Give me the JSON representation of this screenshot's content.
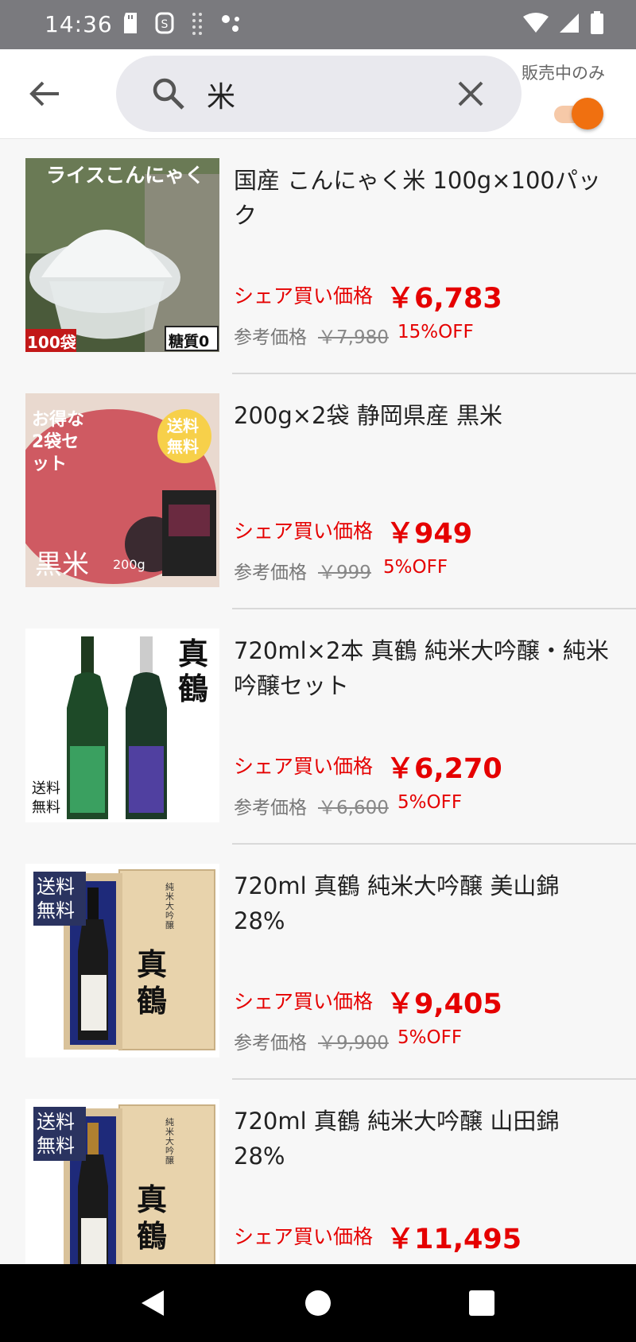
{
  "status_bar": {
    "time": "14:36"
  },
  "header": {
    "search_value": "米",
    "toggle_label": "販売中のみ",
    "toggle_on": true,
    "accent_color": "#f07010"
  },
  "items": [
    {
      "title": "国産 こんにゃく米 100g×100パック",
      "price_label": "シェア買い価格",
      "price": "￥6,783",
      "ref_label": "参考価格",
      "ref_price": "￥7,980",
      "discount": "15%OFF",
      "image": {
        "caption": "ライスこんにゃく",
        "badge_left": "100袋",
        "badge_right": "糖質0"
      }
    },
    {
      "title": "200g×2袋 静岡県産 黒米",
      "price_label": "シェア買い価格",
      "price": "￥949",
      "ref_label": "参考価格",
      "ref_price": "￥999",
      "discount": "5%OFF",
      "image": {
        "caption": "お得な2袋セット",
        "badge_right": "送料無料",
        "bottom": "黒米",
        "weight": "200g"
      }
    },
    {
      "title": "720ml×2本 真鶴 純米大吟醸・純米吟醸セット",
      "price_label": "シェア買い価格",
      "price": "￥6,270",
      "ref_label": "参考価格",
      "ref_price": "￥6,600",
      "discount": "5%OFF",
      "image": {
        "brand": "真鶴",
        "badge": "送料無料"
      }
    },
    {
      "title": "720ml 真鶴 純米大吟醸 美山錦 28%",
      "price_label": "シェア買い価格",
      "price": "￥9,405",
      "ref_label": "参考価格",
      "ref_price": "￥9,900",
      "discount": "5%OFF",
      "image": {
        "brand": "真鶴",
        "badge": "送料無料",
        "box_text": "純米大吟醸"
      }
    },
    {
      "title": "720ml 真鶴 純米大吟醸 山田錦 28%",
      "price_label": "シェア買い価格",
      "price": "￥11,495",
      "image": {
        "brand": "真鶴",
        "badge": "送料無料",
        "box_text": "純米大吟醸"
      }
    }
  ]
}
